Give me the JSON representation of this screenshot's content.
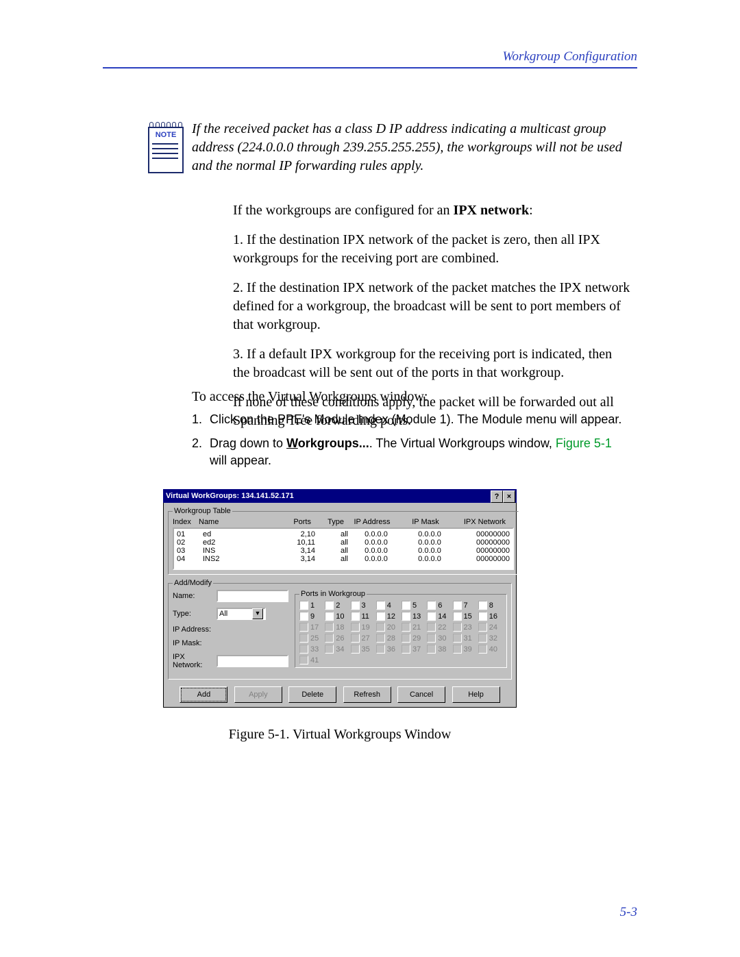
{
  "header": {
    "section_title": "Workgroup Configuration"
  },
  "note": {
    "badge": "NOTE",
    "text": "If the received packet has a class D IP address indicating a multicast group address (224.0.0.0 through 239.255.255.255), the workgroups will not be used and the normal IP forwarding rules apply."
  },
  "body": {
    "intro_prefix": "If the workgroups are configured for an ",
    "intro_bold": "IPX network",
    "intro_suffix": ":",
    "p1": "1. If the destination IPX network of the packet is zero, then all IPX workgroups for the receiving port are combined.",
    "p2": "2. If the destination IPX network of the packet matches the IPX network defined for a workgroup, the broadcast will be sent to port members of that workgroup.",
    "p3": "3. If a default IPX workgroup for the receiving port is indicated, then the broadcast will be sent out of the ports in that workgroup.",
    "p4": "If none of these conditions apply, the packet will be forwarded out all Spanning Tree forwarding ports."
  },
  "access": {
    "lead": "To access the Virtual Workgroups window:",
    "steps": [
      {
        "num": "1.",
        "text": "Click on the PPE's Module Index (Module 1). The Module menu will appear."
      },
      {
        "num": "2.",
        "prefix": "Drag down to ",
        "menu_u": "W",
        "menu_rest": "orkgroups...",
        "mid": ". The Virtual Workgroups window, ",
        "link": "Figure 5-1",
        "suffix": " will appear."
      }
    ]
  },
  "dialog": {
    "title": "Virtual WorkGroups: 134.141.52.171",
    "help_btn": "?",
    "close_btn": "×",
    "group_table_legend": "Workgroup Table",
    "headers": {
      "index": "Index",
      "name": "Name",
      "ports": "Ports",
      "type": "Type",
      "ip": "IP Address",
      "mask": "IP Mask",
      "ipx": "IPX Network"
    },
    "rows": [
      {
        "index": "01",
        "name": "ed",
        "ports": "2,10",
        "type": "all",
        "ip": "0.0.0.0",
        "mask": "0.0.0.0",
        "ipx": "00000000"
      },
      {
        "index": "02",
        "name": "ed2",
        "ports": "10,11",
        "type": "all",
        "ip": "0.0.0.0",
        "mask": "0.0.0.0",
        "ipx": "00000000"
      },
      {
        "index": "03",
        "name": "INS",
        "ports": "3,14",
        "type": "all",
        "ip": "0.0.0.0",
        "mask": "0.0.0.0",
        "ipx": "00000000"
      },
      {
        "index": "04",
        "name": "INS2",
        "ports": "3,14",
        "type": "all",
        "ip": "0.0.0.0",
        "mask": "0.0.0.0",
        "ipx": "00000000"
      }
    ],
    "addmod_legend": "Add/Modify",
    "labels": {
      "name": "Name:",
      "type": "Type:",
      "ip": "IP Address:",
      "mask": "IP Mask:",
      "ipx": "IPX Network:"
    },
    "values": {
      "name": "",
      "type": "All",
      "ip": "",
      "mask": "",
      "ipx": ""
    },
    "ports_legend": "Ports in Workgroup",
    "port_count": 41,
    "port_enabled_max": 16,
    "buttons": {
      "add": "Add",
      "apply": "Apply",
      "delete": "Delete",
      "refresh": "Refresh",
      "cancel": "Cancel",
      "help": "Help"
    }
  },
  "figure_caption": "Figure 5-1. Virtual Workgroups Window",
  "page_number": "5-3"
}
